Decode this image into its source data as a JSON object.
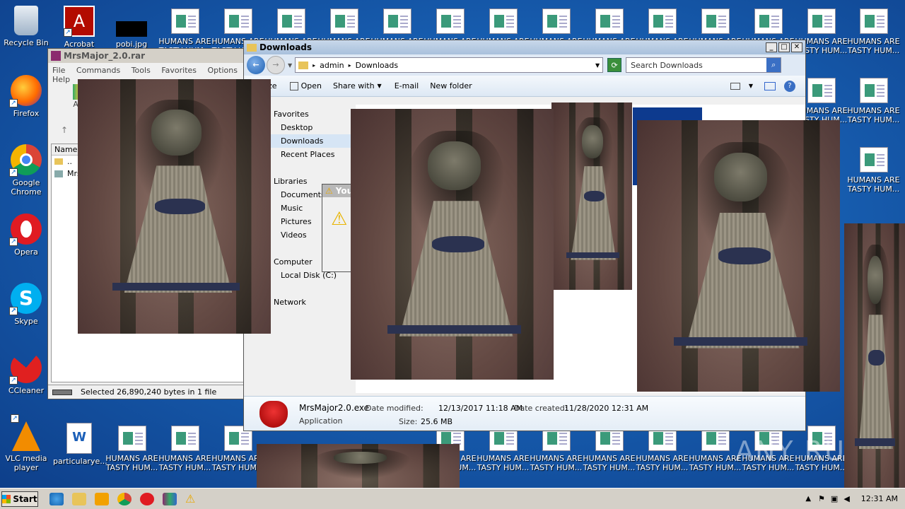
{
  "desktop": {
    "left_icons": [
      {
        "label": "Recycle Bin",
        "icon": "recycle-bin-icon"
      },
      {
        "label": "Firefox",
        "icon": "firefox-icon"
      },
      {
        "label": "Google Chrome",
        "icon": "chrome-icon"
      },
      {
        "label": "Opera",
        "icon": "opera-icon"
      },
      {
        "label": "Skype",
        "icon": "skype-icon"
      },
      {
        "label": "CCleaner",
        "icon": "ccleaner-icon"
      },
      {
        "label": "VLC media player",
        "icon": "vlc-icon"
      }
    ],
    "top_icons": [
      {
        "label": "Acrobat",
        "icon": "acrobat-icon"
      },
      {
        "label": "pobi.jpg",
        "icon": "image-file-icon"
      }
    ],
    "bottom_doc_label": "particularye...",
    "humans_label": "HUMANS ARE TASTY HUM...",
    "watermark": "ANY RUN"
  },
  "winrar": {
    "title": "MrsMajor_2.0.rar",
    "menu": [
      "File",
      "Commands",
      "Tools",
      "Favorites",
      "Options",
      "Help"
    ],
    "toolbar_add": "Add",
    "column_name": "Name",
    "rows": [
      "..",
      "Mrs"
    ],
    "status": "Selected 26,890,240 bytes in 1 file"
  },
  "explorer": {
    "title": "Downloads",
    "breadcrumb": [
      "admin",
      "Downloads"
    ],
    "search_placeholder": "Search Downloads",
    "toolbar": [
      "nize",
      "Open",
      "Share with",
      "E-mail",
      "New folder"
    ],
    "nav": {
      "favorites": "Favorites",
      "fav_items": [
        "Desktop",
        "Downloads",
        "Recent Places"
      ],
      "libraries": "Libraries",
      "lib_items": [
        "Documents",
        "Music",
        "Pictures",
        "Videos"
      ],
      "computer": "Computer",
      "comp_items": [
        "Local Disk (C:)"
      ],
      "network": "Network"
    },
    "details": {
      "filename": "MrsMajor2.0.exe",
      "type": "Application",
      "modified_label": "Date modified:",
      "modified": "12/13/2017 11:18 AM",
      "created_label": "Date created:",
      "created": "11/28/2020 12:31 AM",
      "size_label": "Size:",
      "size": "25.6 MB"
    }
  },
  "dialog": {
    "title_fragment": "You",
    "button_fragment": "e"
  },
  "taskbar": {
    "start": "Start",
    "clock": "12:31 AM"
  }
}
